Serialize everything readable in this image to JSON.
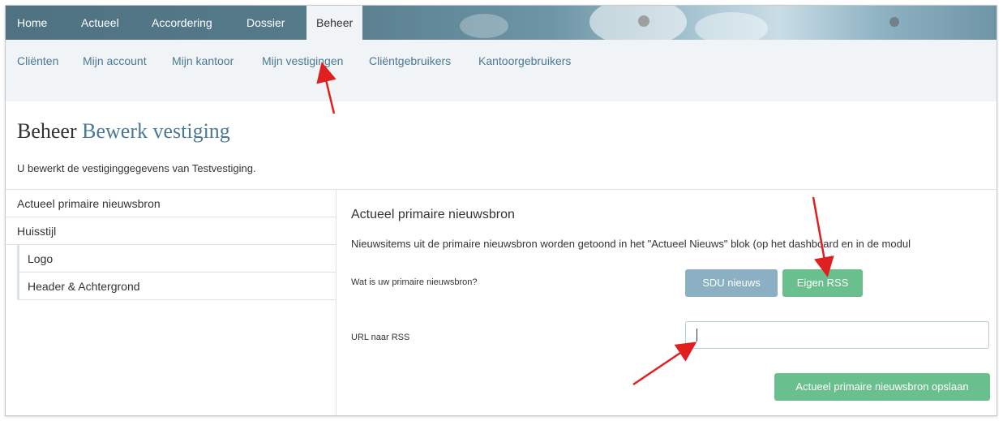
{
  "topnav": {
    "tabs": [
      {
        "label": "Home"
      },
      {
        "label": "Actueel"
      },
      {
        "label": "Accordering"
      },
      {
        "label": "Dossier"
      },
      {
        "label": "Beheer"
      }
    ]
  },
  "subnav": {
    "links": [
      {
        "label": "Cliënten"
      },
      {
        "label": "Mijn account"
      },
      {
        "label": "Mijn kantoor"
      },
      {
        "label": "Mijn vestigingen"
      },
      {
        "label": "Cliëntgebruikers"
      },
      {
        "label": "Kantoorgebruikers"
      }
    ]
  },
  "page": {
    "title_prefix": "Beheer",
    "title_accent": "Bewerk vestiging",
    "intro": "U bewerkt de vestiginggegevens van Testvestiging."
  },
  "leftmenu": {
    "items": [
      {
        "label": "Actueel primaire nieuwsbron"
      },
      {
        "label": "Huisstijl"
      }
    ],
    "subitems": [
      {
        "label": "Logo"
      },
      {
        "label": "Header & Achtergrond"
      }
    ]
  },
  "panel": {
    "title": "Actueel primaire nieuwsbron",
    "description": "Nieuwsitems uit de primaire nieuwsbron worden getoond in het \"Actueel Nieuws\" blok (op het dashboard en in de modul",
    "question": "Wat is uw primaire nieuwsbron?",
    "btn_sdu": "SDU nieuws",
    "btn_rss": "Eigen RSS",
    "url_label": "URL naar RSS",
    "url_value": "",
    "save_label": "Actueel primaire nieuwsbron opslaan"
  },
  "colors": {
    "accent": "#4a7a93",
    "green": "#6ac08c",
    "blue_button": "#8bb0c4",
    "annotation_arrow": "#e02020"
  }
}
